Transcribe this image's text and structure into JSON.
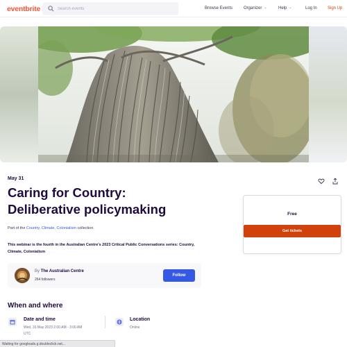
{
  "header": {
    "logo": "eventbrite",
    "search_placeholder": "Search events",
    "nav": {
      "browse": "Browse Events",
      "organizer": "Organizer",
      "help": "Help",
      "login": "Log In",
      "signup": "Sign Up"
    }
  },
  "hero": {
    "image": "banyan-fig-tree-photo"
  },
  "event": {
    "date": "May 31",
    "title_line1": "Caring for Country:",
    "title_line2": "Deliberative policymaking",
    "collection_prefix": "Part of the ",
    "collection_link": "Country, Climate, Colonialism",
    "collection_suffix": " collection",
    "summary": "This webinar is the fourth in the Australian Centre's 2023 Critical Public Conversations series: Country, Climate, Colonialism"
  },
  "organizer": {
    "by": "By",
    "name": "The Australian Centre",
    "followers": "264 followers",
    "follow_label": "Follow"
  },
  "when_where": {
    "title": "When and where",
    "date_heading": "Date and time",
    "date_line1": "Wed, 31 May 2023 2:00 AM - 3:00 AM",
    "date_line2": "UTC",
    "location_heading": "Location",
    "location_value": "Online"
  },
  "ticket": {
    "price": "Free",
    "cta": "Get tickets"
  },
  "status_bar": "Waiting for googleads.g.doubleclick.net...",
  "colors": {
    "brand": "#f05537",
    "cta": "#d1410c",
    "link": "#3659e3",
    "text": "#1e0a3c"
  }
}
